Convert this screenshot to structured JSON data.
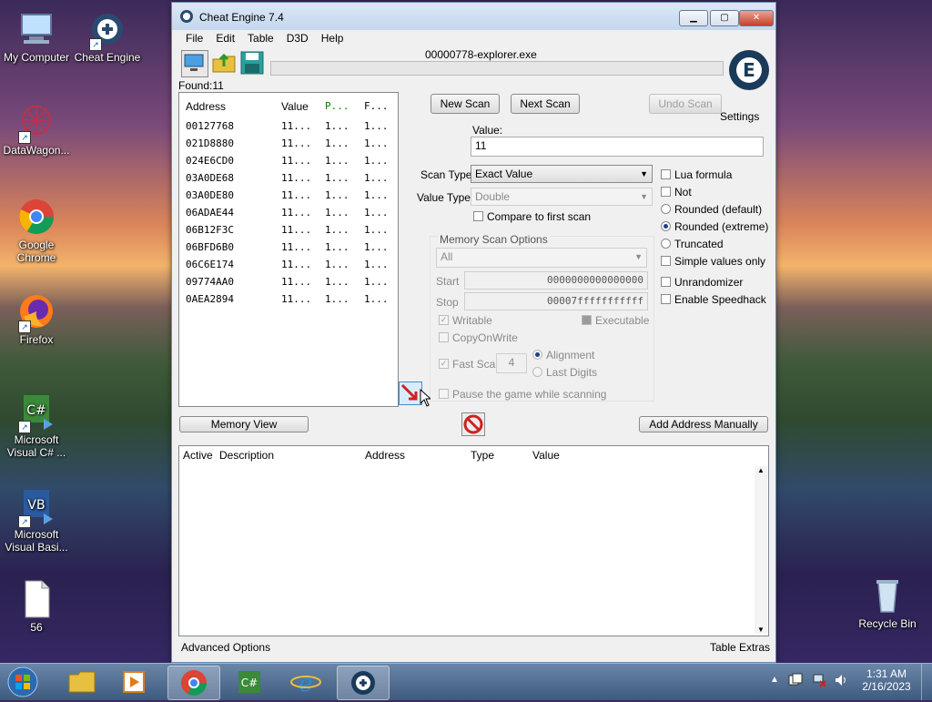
{
  "desktop": {
    "icons": [
      {
        "label": "My Computer",
        "icon": "computer-icon"
      },
      {
        "label": "Cheat Engine",
        "icon": "cheat-engine-icon"
      },
      {
        "label": "DataWagon...",
        "icon": "datawagon-icon"
      },
      {
        "label": "Google Chrome",
        "icon": "chrome-icon"
      },
      {
        "label": "Firefox",
        "icon": "firefox-icon"
      },
      {
        "label": "Microsoft Visual C# ...",
        "icon": "visual-csharp-icon"
      },
      {
        "label": "Microsoft Visual Basi...",
        "icon": "visual-basic-icon"
      },
      {
        "label": "56",
        "icon": "file-icon"
      },
      {
        "label": "Recycle Bin",
        "icon": "recycle-bin-icon"
      }
    ]
  },
  "window": {
    "title": "Cheat Engine 7.4",
    "menu": [
      "File",
      "Edit",
      "Table",
      "D3D",
      "Help"
    ],
    "process": "00000778-explorer.exe",
    "found_label": "Found:",
    "found_count": "11",
    "settings_label": "Settings",
    "results": {
      "columns": [
        "Address",
        "Value",
        "P...",
        "F..."
      ],
      "rows": [
        {
          "address": "00127768",
          "value": "11...",
          "p": "1...",
          "f": "1..."
        },
        {
          "address": "021D8880",
          "value": "11...",
          "p": "1...",
          "f": "1..."
        },
        {
          "address": "024E6CD0",
          "value": "11...",
          "p": "1...",
          "f": "1..."
        },
        {
          "address": "03A0DE68",
          "value": "11...",
          "p": "1...",
          "f": "1..."
        },
        {
          "address": "03A0DE80",
          "value": "11...",
          "p": "1...",
          "f": "1..."
        },
        {
          "address": "06ADAE44",
          "value": "11...",
          "p": "1...",
          "f": "1..."
        },
        {
          "address": "06B12F3C",
          "value": "11...",
          "p": "1...",
          "f": "1..."
        },
        {
          "address": "06BFD6B0",
          "value": "11...",
          "p": "1...",
          "f": "1..."
        },
        {
          "address": "06C6E174",
          "value": "11...",
          "p": "1...",
          "f": "1..."
        },
        {
          "address": "09774AA0",
          "value": "11...",
          "p": "1...",
          "f": "1..."
        },
        {
          "address": "0AEA2894",
          "value": "11...",
          "p": "1...",
          "f": "1..."
        }
      ]
    },
    "buttons": {
      "new_scan": "New Scan",
      "next_scan": "Next Scan",
      "undo_scan": "Undo Scan",
      "memory_view": "Memory View",
      "add_address": "Add Address Manually"
    },
    "scan": {
      "value_label": "Value:",
      "value": "11",
      "scan_type_label": "Scan Type",
      "scan_type": "Exact Value",
      "value_type_label": "Value Type",
      "value_type": "Double",
      "compare_first": "Compare to first scan",
      "lua_formula": "Lua formula",
      "not": "Not",
      "rounded_default": "Rounded (default)",
      "rounded_extreme": "Rounded (extreme)",
      "truncated": "Truncated",
      "simple_values": "Simple values only",
      "unrandomizer": "Unrandomizer",
      "speedhack": "Enable Speedhack"
    },
    "memory_options": {
      "title": "Memory Scan Options",
      "region": "All",
      "start_label": "Start",
      "start": "0000000000000000",
      "stop_label": "Stop",
      "stop": "00007fffffffffff",
      "writable": "Writable",
      "executable": "Executable",
      "copy_on_write": "CopyOnWrite",
      "fast_scan": "Fast Scan",
      "fast_scan_value": "4",
      "alignment": "Alignment",
      "last_digits": "Last Digits",
      "pause_game": "Pause the game while scanning"
    },
    "address_table": {
      "columns": [
        "Active",
        "Description",
        "Address",
        "Type",
        "Value"
      ]
    },
    "footer": {
      "advanced": "Advanced Options",
      "table_extras": "Table Extras"
    }
  },
  "taskbar": {
    "time": "1:31 AM",
    "date": "2/16/2023"
  }
}
